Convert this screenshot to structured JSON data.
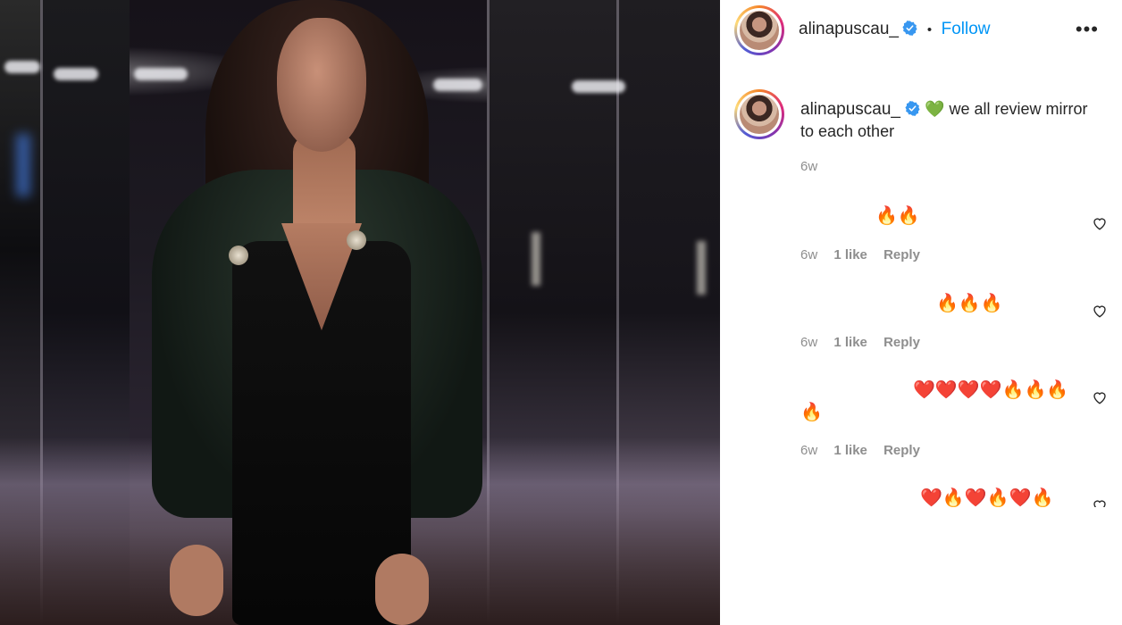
{
  "post": {
    "username": "alinapuscau_",
    "dot": "•",
    "follow_label": "Follow",
    "more_icon": "•••"
  },
  "caption": {
    "username": "alinapuscau_",
    "emoji": "💚",
    "text": "we all review mirror to each other",
    "time": "6w"
  },
  "comments": [
    {
      "text": "🔥🔥",
      "time": "6w",
      "likes": "1 like",
      "reply": "Reply"
    },
    {
      "text": "🔥🔥🔥",
      "time": "6w",
      "likes": "1 like",
      "reply": "Reply"
    },
    {
      "text": "❤️❤️❤️❤️🔥🔥🔥",
      "text_wrap": "🔥",
      "time": "6w",
      "likes": "1 like",
      "reply": "Reply"
    },
    {
      "text": "❤️🔥❤️🔥❤️🔥"
    }
  ],
  "colors": {
    "follow": "#0095f6",
    "verified": "#3897f0",
    "meta_gray": "#8e8e8e"
  },
  "icons": {
    "verified": "verified-badge-icon",
    "like": "heart-outline-icon",
    "more": "more-options-icon"
  }
}
